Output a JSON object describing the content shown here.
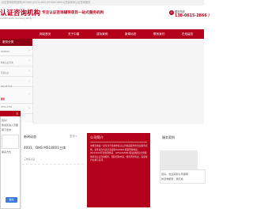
{
  "topbar": {
    "text": "认证咨询机构官网|ISO9001|ISO14001|OHSAS18001|质量体系认证咨询服务"
  },
  "header": {
    "logo_title": "认证咨询机构",
    "logo_sub": "Certification Advisory Body",
    "slogan": "专注认证咨询辅导项目一站式服务机构",
    "phone_icon": "phone-icon",
    "phone_label": "服务热线",
    "phone_number": "138-0615-2866 /"
  },
  "nav": {
    "items": [
      "网站首页",
      "关于中鼎",
      "成功案例",
      "新闻动态",
      "联系我们",
      "在线留言"
    ]
  },
  "sidebar": {
    "head": "服务分类",
    "items": [
      {
        "text": "ISO9001",
        "red": false
      },
      {
        "text": "体系认证咨询",
        "red": false
      },
      {
        "text": "环境认证",
        "red": false
      },
      {
        "text": "ISO 45 FCC",
        "red": false
      },
      {
        "text": "服务",
        "red": true
      },
      {
        "text": "0755-1705",
        "red": false
      }
    ]
  },
  "popup": {
    "close": "✕",
    "line1": "您好！",
    "line2": "欢迎您进入页面",
    "line3": "留下您的",
    "line4": "联系方式",
    "button": "提交"
  },
  "news": {
    "title": "新闻动态",
    "more": "更多+",
    "line1": "4001、OHS MS18001三体",
    "line2": "三体系认证"
  },
  "intro": {
    "title": "公司简介",
    "body": "中鼎咨询是一家专注于各类体系认证咨询及辅导的专业服务机构，多年来为众多企业提供ISO9001质量管理体系、ISO14001环境管理体系、OHSAS18001职业健康安全管理体系等认证咨询服务，团队经验丰富，服务周到专业，深受客户信赖与好评。"
  },
  "cases": {
    "title": "服务案例",
    "caption1": "您好，欢迎来到公司官网",
    "caption2": "的咨询服务，我们会"
  }
}
